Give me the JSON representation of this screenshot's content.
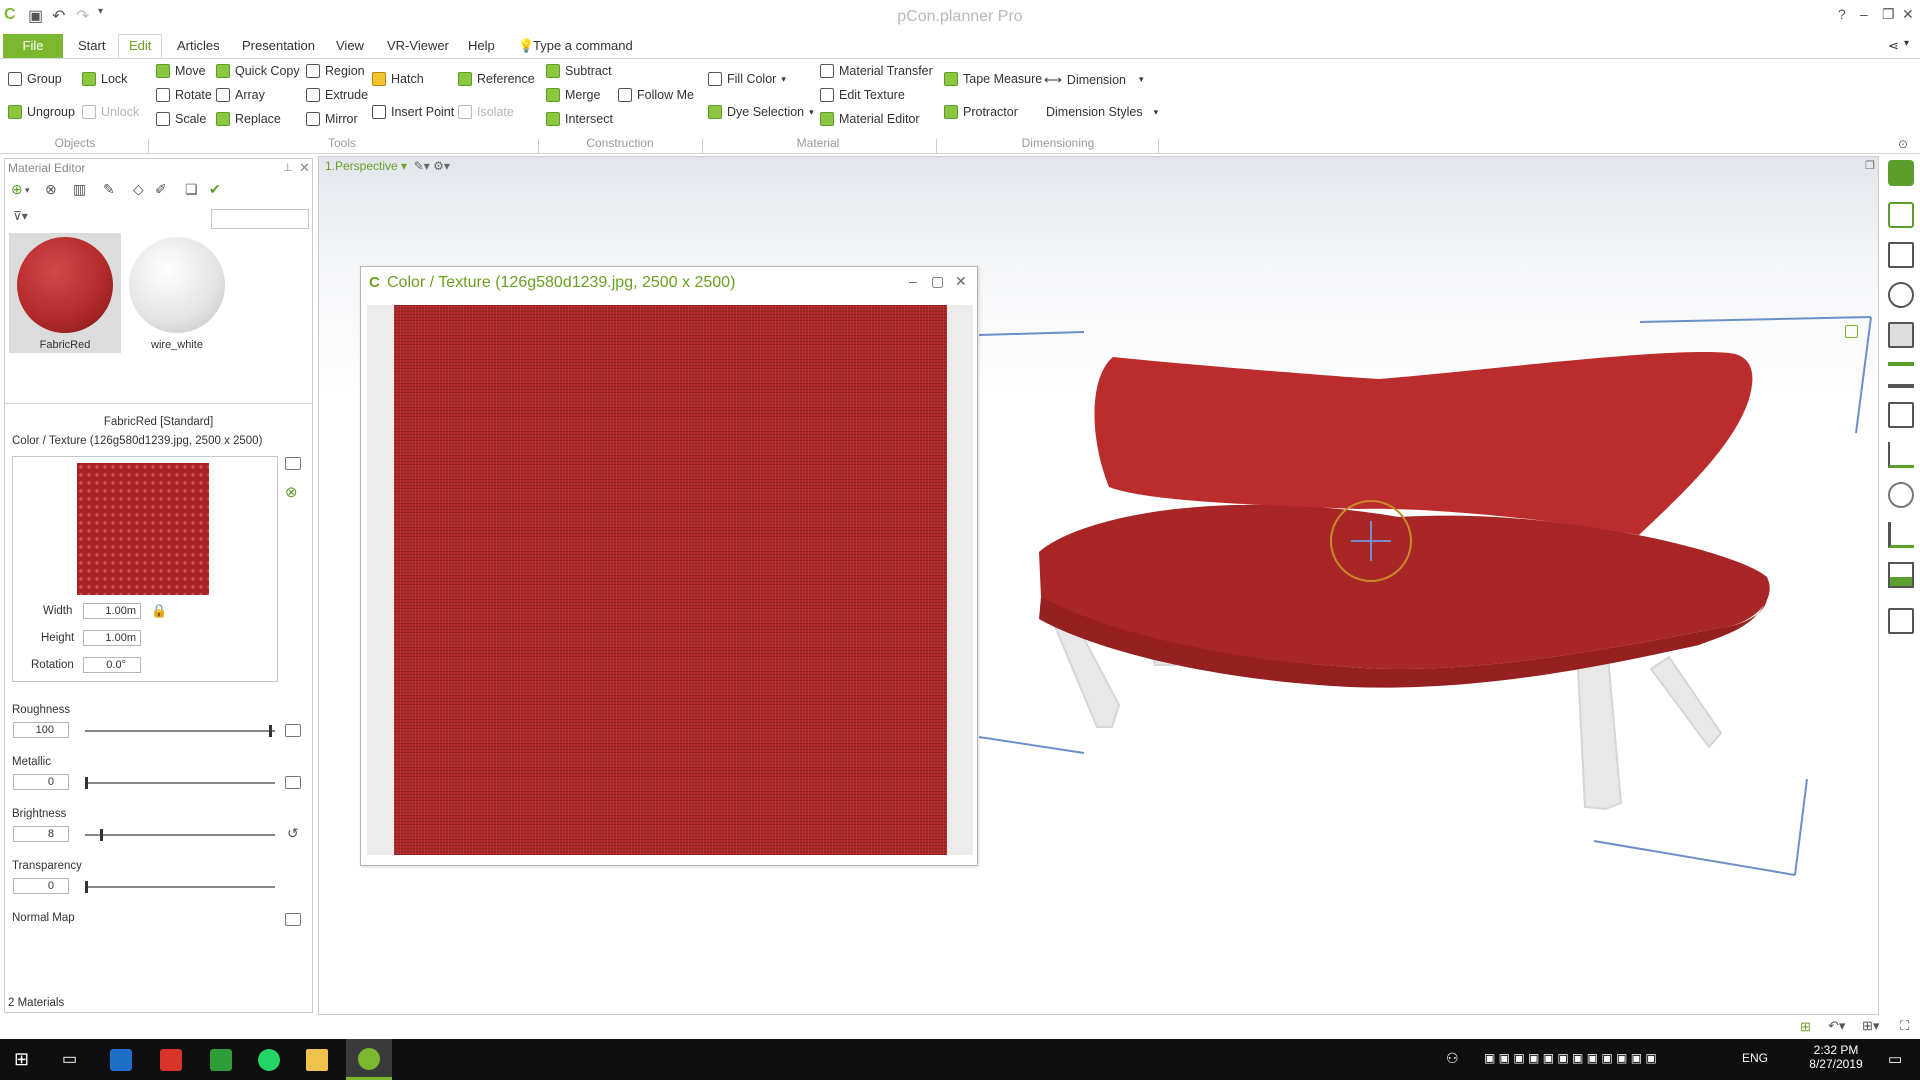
{
  "window": {
    "title": "pCon.planner Pro",
    "help": "?"
  },
  "tabs": {
    "file": "File",
    "start": "Start",
    "edit": "Edit",
    "articles": "Articles",
    "presentation": "Presentation",
    "view": "View",
    "vr": "VR-Viewer",
    "help": "Help",
    "command": "Type a command"
  },
  "ribbon": {
    "objects": {
      "group": "Group",
      "ungroup": "Ungroup",
      "lock": "Lock",
      "unlock": "Unlock",
      "label": "Objects"
    },
    "tools": {
      "move": "Move",
      "rotate": "Rotate",
      "scale": "Scale",
      "quick_copy": "Quick Copy",
      "array": "Array",
      "replace": "Replace",
      "region": "Region",
      "extrude": "Extrude",
      "mirror": "Mirror",
      "hatch": "Hatch",
      "insert_point": "Insert Point",
      "reference": "Reference",
      "isolate": "Isolate",
      "label": "Tools"
    },
    "construction": {
      "subtract": "Subtract",
      "merge": "Merge",
      "intersect": "Intersect",
      "follow_me": "Follow Me",
      "label": "Construction"
    },
    "material": {
      "fill_color": "Fill Color",
      "dye_selection": "Dye Selection",
      "material_transfer": "Material Transfer",
      "edit_texture": "Edit Texture",
      "material_editor": "Material Editor",
      "label": "Material"
    },
    "dimensioning": {
      "tape_measure": "Tape Measure",
      "dimension": "Dimension",
      "protractor": "Protractor",
      "dimension_styles": "Dimension Styles",
      "label": "Dimensioning"
    }
  },
  "panel": {
    "title": "Material Editor",
    "materials": [
      {
        "name": "FabricRed",
        "color": "#b52b2b"
      },
      {
        "name": "wire_white",
        "color": "#e8e8e8"
      }
    ],
    "selected_material": "FabricRed [Standard]",
    "texture_label": "Color / Texture  (126g580d1239.jpg, 2500 x 2500)",
    "width_label": "Width",
    "width_value": "1.00m",
    "height_label": "Height",
    "height_value": "1.00m",
    "rotation_label": "Rotation",
    "rotation_value": "0.0°",
    "roughness_label": "Roughness",
    "roughness_value": "100",
    "metallic_label": "Metallic",
    "metallic_value": "0",
    "brightness_label": "Brightness",
    "brightness_value": "8",
    "transparency_label": "Transparency",
    "transparency_value": "0",
    "normal_map_label": "Normal Map",
    "footer": "2 Materials"
  },
  "viewport": {
    "label": "1.Perspective"
  },
  "dialog": {
    "title": "Color / Texture   (126g580d1239.jpg, 2500 x 2500)"
  },
  "taskbar": {
    "lang": "ENG",
    "time": "2:32 PM",
    "date": "8/27/2019"
  },
  "colors": {
    "accent": "#7cb82f",
    "fabric": "#b02626"
  }
}
